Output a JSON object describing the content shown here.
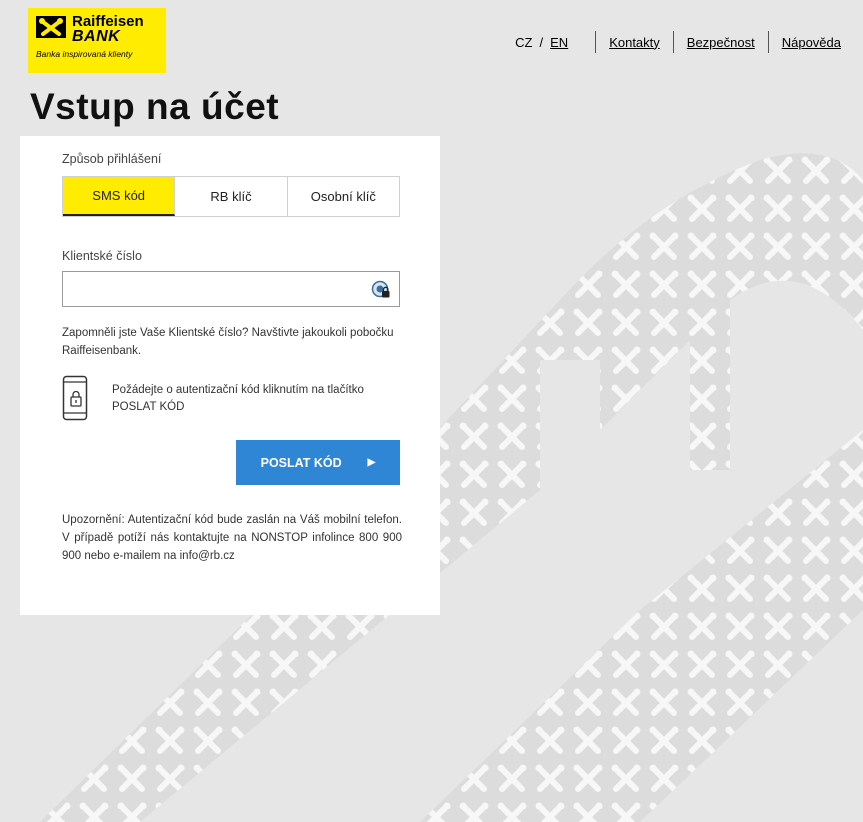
{
  "brand": {
    "name_line1": "Raiffeisen",
    "name_line2": "BANK",
    "tagline": "Banka inspirovaná klienty",
    "color": "#ffec00"
  },
  "nav": {
    "lang_cz": "CZ",
    "lang_sep": "/",
    "lang_en": "EN",
    "contacts": "Kontakty",
    "security": "Bezpečnost",
    "help": "Nápověda"
  },
  "page": {
    "title": "Vstup na účet"
  },
  "login": {
    "method_label": "Způsob přihlášení",
    "tabs": [
      {
        "label": "SMS kód",
        "active": true
      },
      {
        "label": "RB klíč",
        "active": false
      },
      {
        "label": "Osobní klíč",
        "active": false
      }
    ],
    "client_number_label": "Klientské číslo",
    "client_number_value": "",
    "forgot_hint": "Zapomněli jste Vaše Klientské číslo? Navštivte jakoukoli pobočku Raiffeisenbank.",
    "sms_info": "Požádejte o autentizační kód kliknutím na tlačítko POSLAT KÓD",
    "send_button": "POSLAT KÓD",
    "notice": "Upozornění: Autentizační kód bude zaslán na Váš mobilní telefon. V případě potíží nás kontaktujte na NONSTOP infolince 800 900 900 nebo e-mailem na info@rb.cz"
  },
  "colors": {
    "accent_yellow": "#ffec00",
    "button_blue": "#2f86d5",
    "background": "#e6e6e6"
  },
  "icons": [
    "raiffeisen-logo-icon",
    "password-manager-icon",
    "phone-lock-icon",
    "chevron-right-icon"
  ]
}
